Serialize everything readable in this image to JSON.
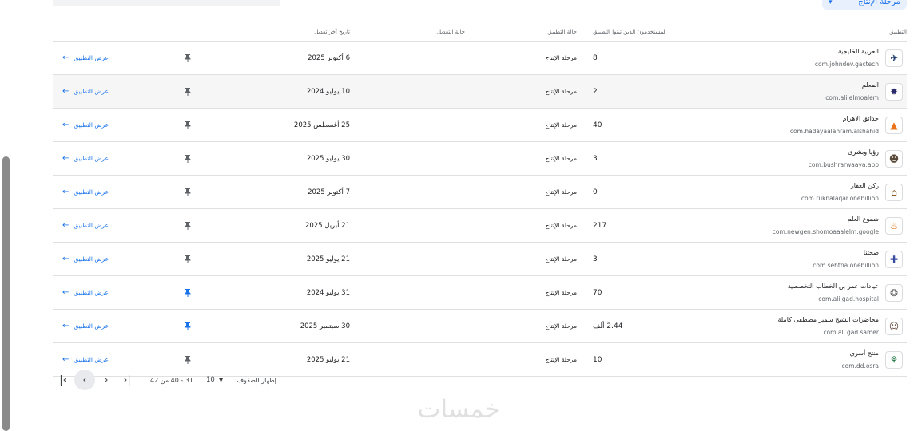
{
  "top": {
    "filter_chip_label": "مرحلة الإنتاج"
  },
  "table": {
    "headers": {
      "app": "التطبيق",
      "users": "المستخدمون الذين ثبتوا التطبيق",
      "status": "حالة التطبيق",
      "update_status": "حالة التعديل",
      "last_update": "تاريخ آخر تعديل"
    },
    "view_label": "عرض التطبيق",
    "rows": [
      {
        "name": "العربية الخليجية",
        "package": "com.johndev.gactech",
        "users": "8",
        "status": "مرحلة الإنتاج",
        "date": "6 أكتوبر 2025",
        "pinned": false,
        "icon": "gulf-arabic-app-icon",
        "glyph": "✈",
        "icon_color": "#1e3a6e"
      },
      {
        "name": "المعلم",
        "package": "com.ali.elmoalem",
        "users": "2",
        "status": "مرحلة الإنتاج",
        "date": "10 يوليو 2024",
        "pinned": false,
        "icon": "teacher-app-icon",
        "glyph": "✹",
        "icon_color": "#2b2b6b"
      },
      {
        "name": "حدائق الاهرام",
        "package": "com.hadayaalahram.alshahid",
        "users": "40",
        "status": "مرحلة الإنتاج",
        "date": "25 أغسطس 2025",
        "pinned": false,
        "icon": "pyramids-gardens-app-icon",
        "glyph": "▲",
        "icon_color": "#e8731a"
      },
      {
        "name": "رؤيا وبشرى",
        "package": "com.bushrarwaaya.app",
        "users": "3",
        "status": "مرحلة الإنتاج",
        "date": "30 يوليو 2025",
        "pinned": false,
        "icon": "vision-app-icon",
        "glyph": "☻",
        "icon_color": "#5a4a3a"
      },
      {
        "name": "ركن العقار",
        "package": "com.ruknalaqar.onebillion",
        "users": "0",
        "status": "مرحلة الإنتاج",
        "date": "7 أكتوبر 2025",
        "pinned": false,
        "icon": "real-estate-app-icon",
        "glyph": "⌂",
        "icon_color": "#8a5a2a"
      },
      {
        "name": "شموع العلم",
        "package": "com.newgen.shomoaaalelm.google",
        "users": "217",
        "status": "مرحلة الإنتاج",
        "date": "21 أبريل 2025",
        "pinned": false,
        "icon": "candles-app-icon",
        "glyph": "♨",
        "icon_color": "#e07a1f"
      },
      {
        "name": "صحتنا",
        "package": "com.sehtna.onebillion",
        "users": "3",
        "status": "مرحلة الإنتاج",
        "date": "21 يوليو 2025",
        "pinned": false,
        "icon": "health-app-icon",
        "glyph": "✚",
        "icon_color": "#3b4ba0"
      },
      {
        "name": "عيادات عمر بن الخطاب التخصصية",
        "package": "com.ali.gad.hospital",
        "users": "70",
        "status": "مرحلة الإنتاج",
        "date": "31 يوليو 2024",
        "pinned": true,
        "icon": "clinic-app-icon",
        "glyph": "❂",
        "icon_color": "#6b6b6b"
      },
      {
        "name": "محاضرات الشيخ سمير مصطفى كاملة",
        "package": "com.ali.gad.samer",
        "users": "2.44 ألف",
        "status": "مرحلة الإنتاج",
        "date": "30 سبتمبر 2025",
        "pinned": true,
        "icon": "lectures-app-icon",
        "glyph": "☺",
        "icon_color": "#5a4030"
      },
      {
        "name": "منتج أسري",
        "package": "com.dd.osra",
        "users": "10",
        "status": "مرحلة الإنتاج",
        "date": "21 يوليو 2025",
        "pinned": false,
        "icon": "family-product-app-icon",
        "glyph": "⚘",
        "icon_color": "#2e7d4f"
      }
    ]
  },
  "pager": {
    "page_size_label": "إظهار الصفوف:",
    "page_size": "10",
    "range": "31 - 40 من 42"
  },
  "watermark": "خمسات",
  "colors": {
    "accent": "#1a73e8",
    "pin_active": "#1a73e8",
    "pin_inactive": "#5f6368"
  }
}
